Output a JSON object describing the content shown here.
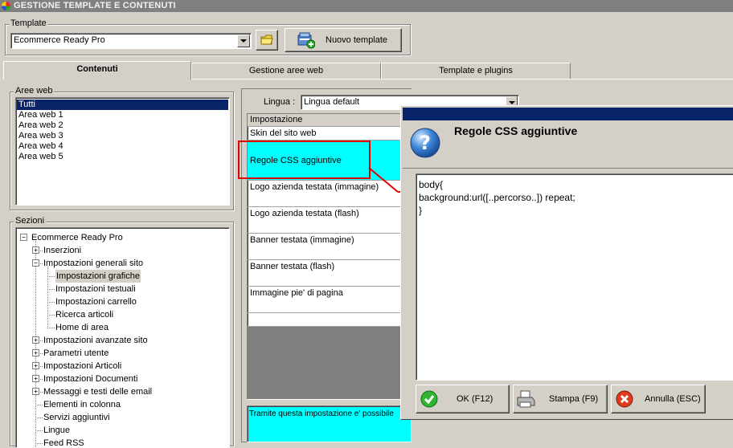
{
  "window": {
    "title": "GESTIONE TEMPLATE E CONTENUTI"
  },
  "template": {
    "group_label": "Template",
    "selected": "Ecommerce Ready Pro",
    "new_button": "Nuovo template"
  },
  "tabs": [
    {
      "label": "Contenuti"
    },
    {
      "label": "Gestione aree web"
    },
    {
      "label": "Template e plugins"
    }
  ],
  "aree_web": {
    "label": "Aree web",
    "items": [
      "Tutti",
      "Area web 1",
      "Area web 2",
      "Area web 3",
      "Area web 4",
      "Area web 5"
    ]
  },
  "sezioni": {
    "label": "Sezioni",
    "tree": [
      {
        "label": "Ecommerce Ready Pro",
        "level": 0,
        "toggle": "−"
      },
      {
        "label": "Inserzioni",
        "level": 1,
        "toggle": "+"
      },
      {
        "label": "Impostazioni generali sito",
        "level": 1,
        "toggle": "−"
      },
      {
        "label": "Impostazioni grafiche",
        "level": 2,
        "toggle": ""
      },
      {
        "label": "Impostazioni testuali",
        "level": 2,
        "toggle": ""
      },
      {
        "label": "Impostazioni carrello",
        "level": 2,
        "toggle": ""
      },
      {
        "label": "Ricerca articoli",
        "level": 2,
        "toggle": ""
      },
      {
        "label": "Home di area",
        "level": 2,
        "toggle": ""
      },
      {
        "label": "Impostazioni avanzate sito",
        "level": 1,
        "toggle": "+"
      },
      {
        "label": "Parametri utente",
        "level": 1,
        "toggle": "+"
      },
      {
        "label": "Impostazioni Articoli",
        "level": 1,
        "toggle": "+"
      },
      {
        "label": "Impostazioni Documenti",
        "level": 1,
        "toggle": "+"
      },
      {
        "label": "Messaggi e testi delle email",
        "level": 1,
        "toggle": "+"
      },
      {
        "label": "Elementi in colonna",
        "level": 1,
        "toggle": ""
      },
      {
        "label": "Servizi aggiuntivi",
        "level": 1,
        "toggle": ""
      },
      {
        "label": "Lingue",
        "level": 1,
        "toggle": ""
      },
      {
        "label": "Feed RSS",
        "level": 1,
        "toggle": ""
      }
    ]
  },
  "lingua": {
    "label": "Lingua :",
    "selected": "Lingua default"
  },
  "grid": {
    "header": "Impostazione",
    "rows": [
      "Skin del sito web",
      "Regole CSS aggiuntive",
      "Logo azienda testata (immagine)",
      "Logo azienda testata (flash)",
      "Banner testata (immagine)",
      "Banner testata (flash)",
      "Immagine pie' di pagina"
    ]
  },
  "description": "Tramite questa impostazione e' possibile",
  "dialog": {
    "title": "Regole CSS aggiuntive",
    "code_lines": [
      "body{",
      "background:url([..percorso..]) repeat;",
      "}"
    ],
    "buttons": [
      {
        "label": "OK (F12)",
        "icon": "check-icon"
      },
      {
        "label": "Stampa (F9)",
        "icon": "printer-icon"
      },
      {
        "label": "Annulla (ESC)",
        "icon": "cancel-icon"
      }
    ]
  },
  "colors": {
    "selection": "#0a246a",
    "highlight_cyan": "#00ffff",
    "annotation_red": "#e00000",
    "dialog_titlebar": "#0a246a"
  }
}
